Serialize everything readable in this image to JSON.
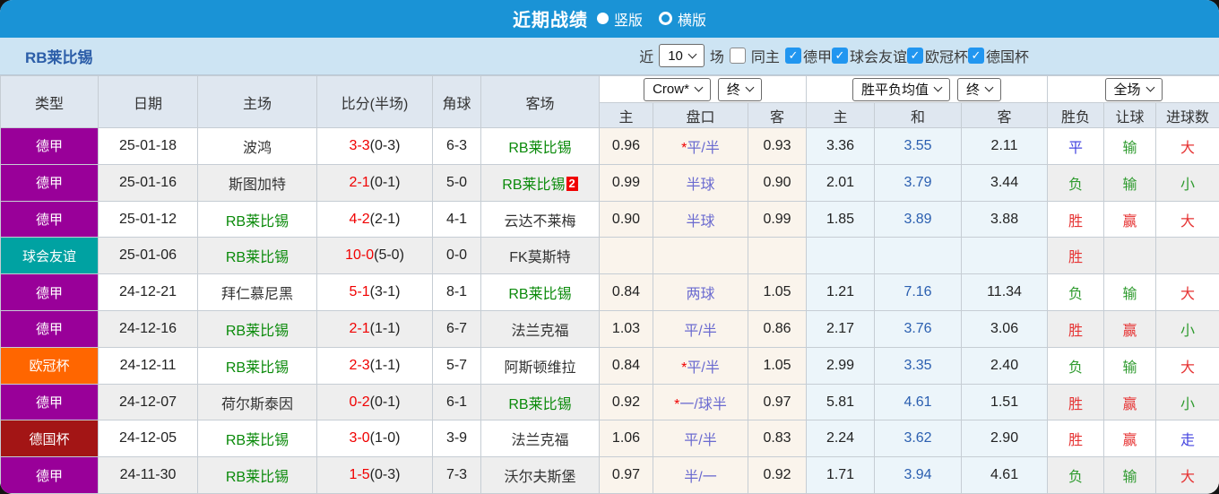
{
  "titlebar": {
    "title": "近期战绩",
    "options": [
      {
        "label": "竖版",
        "selected": true
      },
      {
        "label": "横版",
        "selected": false
      }
    ]
  },
  "filterbar": {
    "team": "RB莱比锡",
    "near_label": "近",
    "count_value": "10",
    "games_label": "场",
    "same_home_label": "同主",
    "same_home_checked": false,
    "leagues": [
      {
        "label": "德甲",
        "checked": true
      },
      {
        "label": "球会友谊",
        "checked": true
      },
      {
        "label": "欧冠杯",
        "checked": true
      },
      {
        "label": "德国杯",
        "checked": true
      }
    ]
  },
  "header": {
    "left_cols": [
      "类型",
      "日期",
      "主场",
      "比分(半场)",
      "角球",
      "客场"
    ],
    "groups": [
      {
        "selects": [
          "Crow*",
          "终"
        ]
      },
      {
        "selects": [
          "胜平负均值",
          "终"
        ]
      },
      {
        "selects": [
          "全场"
        ]
      }
    ],
    "sub_cols": [
      "主",
      "盘口",
      "客",
      "主",
      "和",
      "客",
      "胜负",
      "让球",
      "进球数"
    ]
  },
  "colors": {
    "titlebar_bg": "#1a93d6",
    "filterbar_bg": "#cde4f3",
    "header_bg": "#dfe7f0",
    "badge": {
      "德甲": "#990099",
      "球会友谊": "#00a2a2",
      "欧冠杯": "#ff6600",
      "德国杯": "#a31515"
    },
    "team_green": "#0a8a0a",
    "score_red": "#f00000",
    "handicap_text": "#6b6bd0",
    "draw_odds_blue": "#2b5fb0",
    "result_red": "#e63333",
    "result_green": "#2f9b2f",
    "result_blue": "#4646e0",
    "ah_bg": "#faf4ec",
    "odds_bg": "#ecf5fa",
    "alt_row_bg": "#eeeeee"
  },
  "rows": [
    {
      "type": "德甲",
      "date": "25-01-18",
      "home": "波鸿",
      "home_rb": false,
      "score": "3-3",
      "half": "(0-3)",
      "corners": "6-3",
      "away": "RB莱比锡",
      "away_rb": true,
      "away_card": "",
      "ah_home": "0.96",
      "hcp_star": "*",
      "hcp": "平/半",
      "ah_away": "0.93",
      "o_home": "3.36",
      "o_draw": "3.55",
      "o_away": "2.11",
      "r1": "平",
      "r1c": "blue",
      "r2": "输",
      "r2c": "green",
      "r3": "大",
      "r3c": "red"
    },
    {
      "type": "德甲",
      "date": "25-01-16",
      "home": "斯图加特",
      "home_rb": false,
      "score": "2-1",
      "half": "(0-1)",
      "corners": "5-0",
      "away": "RB莱比锡",
      "away_rb": true,
      "away_card": "2",
      "ah_home": "0.99",
      "hcp_star": "",
      "hcp": "半球",
      "ah_away": "0.90",
      "o_home": "2.01",
      "o_draw": "3.79",
      "o_away": "3.44",
      "r1": "负",
      "r1c": "green",
      "r2": "输",
      "r2c": "green",
      "r3": "小",
      "r3c": "green"
    },
    {
      "type": "德甲",
      "date": "25-01-12",
      "home": "RB莱比锡",
      "home_rb": true,
      "score": "4-2",
      "half": "(2-1)",
      "corners": "4-1",
      "away": "云达不莱梅",
      "away_rb": false,
      "away_card": "",
      "ah_home": "0.90",
      "hcp_star": "",
      "hcp": "半球",
      "ah_away": "0.99",
      "o_home": "1.85",
      "o_draw": "3.89",
      "o_away": "3.88",
      "r1": "胜",
      "r1c": "red",
      "r2": "赢",
      "r2c": "red",
      "r3": "大",
      "r3c": "red"
    },
    {
      "type": "球会友谊",
      "date": "25-01-06",
      "home": "RB莱比锡",
      "home_rb": true,
      "score": "10-0",
      "half": "(5-0)",
      "corners": "0-0",
      "away": "FK莫斯特",
      "away_rb": false,
      "away_card": "",
      "ah_home": "",
      "hcp_star": "",
      "hcp": "",
      "ah_away": "",
      "o_home": "",
      "o_draw": "",
      "o_away": "",
      "r1": "胜",
      "r1c": "red",
      "r2": "",
      "r2c": "red",
      "r3": "",
      "r3c": "red"
    },
    {
      "type": "德甲",
      "date": "24-12-21",
      "home": "拜仁慕尼黑",
      "home_rb": false,
      "score": "5-1",
      "half": "(3-1)",
      "corners": "8-1",
      "away": "RB莱比锡",
      "away_rb": true,
      "away_card": "",
      "ah_home": "0.84",
      "hcp_star": "",
      "hcp": "两球",
      "ah_away": "1.05",
      "o_home": "1.21",
      "o_draw": "7.16",
      "o_away": "11.34",
      "r1": "负",
      "r1c": "green",
      "r2": "输",
      "r2c": "green",
      "r3": "大",
      "r3c": "red"
    },
    {
      "type": "德甲",
      "date": "24-12-16",
      "home": "RB莱比锡",
      "home_rb": true,
      "score": "2-1",
      "half": "(1-1)",
      "corners": "6-7",
      "away": "法兰克福",
      "away_rb": false,
      "away_card": "",
      "ah_home": "1.03",
      "hcp_star": "",
      "hcp": "平/半",
      "ah_away": "0.86",
      "o_home": "2.17",
      "o_draw": "3.76",
      "o_away": "3.06",
      "r1": "胜",
      "r1c": "red",
      "r2": "赢",
      "r2c": "red",
      "r3": "小",
      "r3c": "green"
    },
    {
      "type": "欧冠杯",
      "date": "24-12-11",
      "home": "RB莱比锡",
      "home_rb": true,
      "score": "2-3",
      "half": "(1-1)",
      "corners": "5-7",
      "away": "阿斯顿维拉",
      "away_rb": false,
      "away_card": "",
      "ah_home": "0.84",
      "hcp_star": "*",
      "hcp": "平/半",
      "ah_away": "1.05",
      "o_home": "2.99",
      "o_draw": "3.35",
      "o_away": "2.40",
      "r1": "负",
      "r1c": "green",
      "r2": "输",
      "r2c": "green",
      "r3": "大",
      "r3c": "red"
    },
    {
      "type": "德甲",
      "date": "24-12-07",
      "home": "荷尔斯泰因",
      "home_rb": false,
      "score": "0-2",
      "half": "(0-1)",
      "corners": "6-1",
      "away": "RB莱比锡",
      "away_rb": true,
      "away_card": "",
      "ah_home": "0.92",
      "hcp_star": "*",
      "hcp": "一/球半",
      "ah_away": "0.97",
      "o_home": "5.81",
      "o_draw": "4.61",
      "o_away": "1.51",
      "r1": "胜",
      "r1c": "red",
      "r2": "赢",
      "r2c": "red",
      "r3": "小",
      "r3c": "green"
    },
    {
      "type": "德国杯",
      "date": "24-12-05",
      "home": "RB莱比锡",
      "home_rb": true,
      "score": "3-0",
      "half": "(1-0)",
      "corners": "3-9",
      "away": "法兰克福",
      "away_rb": false,
      "away_card": "",
      "ah_home": "1.06",
      "hcp_star": "",
      "hcp": "平/半",
      "ah_away": "0.83",
      "o_home": "2.24",
      "o_draw": "3.62",
      "o_away": "2.90",
      "r1": "胜",
      "r1c": "red",
      "r2": "赢",
      "r2c": "red",
      "r3": "走",
      "r3c": "blue"
    },
    {
      "type": "德甲",
      "date": "24-11-30",
      "home": "RB莱比锡",
      "home_rb": true,
      "score": "1-5",
      "half": "(0-3)",
      "corners": "7-3",
      "away": "沃尔夫斯堡",
      "away_rb": false,
      "away_card": "",
      "ah_home": "0.97",
      "hcp_star": "",
      "hcp": "半/一",
      "ah_away": "0.92",
      "o_home": "1.71",
      "o_draw": "3.94",
      "o_away": "4.61",
      "r1": "负",
      "r1c": "green",
      "r2": "输",
      "r2c": "green",
      "r3": "大",
      "r3c": "red"
    }
  ]
}
